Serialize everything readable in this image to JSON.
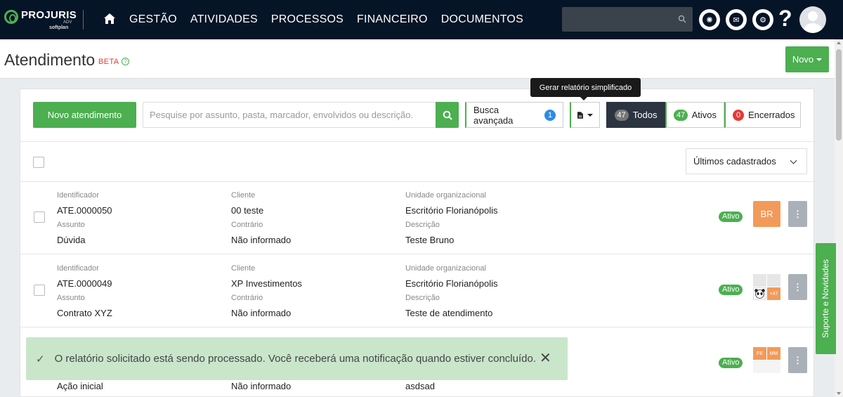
{
  "nav": {
    "logo_main": "PROJURIS",
    "logo_sub": "ADV",
    "logo_by": "softplan",
    "menu": [
      "GESTÃO",
      "ATIVIDADES",
      "PROCESSOS",
      "FINANCEIRO",
      "DOCUMENTOS"
    ],
    "icons": [
      "home-icon",
      "search-icon",
      "openai-icon",
      "mail-icon",
      "settings-icon",
      "help-icon",
      "avatar"
    ],
    "help_glyph": "?"
  },
  "header": {
    "title": "Atendimento",
    "beta": "BETA",
    "beta_help": "?",
    "new_button": "Novo"
  },
  "toolbar": {
    "new_atendimento": "Novo atendimento",
    "search_placeholder": "Pesquise por assunto, pasta, marcador, envolvidos ou descrição.",
    "advanced_search": "Busca avançada",
    "advanced_count": "1",
    "report_tooltip": "Gerar relatório simplificado",
    "tabs": [
      {
        "label": "Todos",
        "count": "47"
      },
      {
        "label": "Ativos",
        "count": "47"
      },
      {
        "label": "Encerrados",
        "count": "0"
      }
    ]
  },
  "sort": {
    "selected": "Últimos cadastrados"
  },
  "labels": {
    "identificador": "Identificador",
    "cliente": "Cliente",
    "unidade": "Unidade organizacional",
    "assunto": "Assunto",
    "contrario": "Contrário",
    "descricao": "Descrição"
  },
  "rows": [
    {
      "id": "ATE.0000050",
      "cliente": "00 teste",
      "unidade": "Escritório Florianópolis",
      "assunto": "Dúvida",
      "contrario": "Não informado",
      "descricao": "Teste Bruno",
      "status": "Ativo",
      "avatar": "BR"
    },
    {
      "id": "ATE.0000049",
      "cliente": "XP Investimentos",
      "unidade": "Escritório Florianópolis",
      "assunto": "Contrato XYZ",
      "contrario": "Não informado",
      "descricao": "Teste de atendimento",
      "status": "Ativo",
      "avatar_more": "+47"
    },
    {
      "assunto": "Ação inicial",
      "contrario": "Não informado",
      "descricao": "asdsad",
      "status": "Ativo",
      "avatar_tags": [
        "FE",
        "MM"
      ]
    }
  ],
  "kebab_glyph": "⋮",
  "toast": {
    "check": "✓",
    "message": "O relatório solicitado está sendo processado. Você receberá uma notificação quando estiver concluído.",
    "close": "✕"
  },
  "support_tab": "Suporte e Novidades",
  "colors": {
    "nav_bg": "#051426",
    "accent_green": "#4caf50",
    "badge_blue": "#2b8ce6",
    "badge_red": "#e53935",
    "avatar_orange": "#f39a5a",
    "toast_bg": "#c9e6cb"
  }
}
